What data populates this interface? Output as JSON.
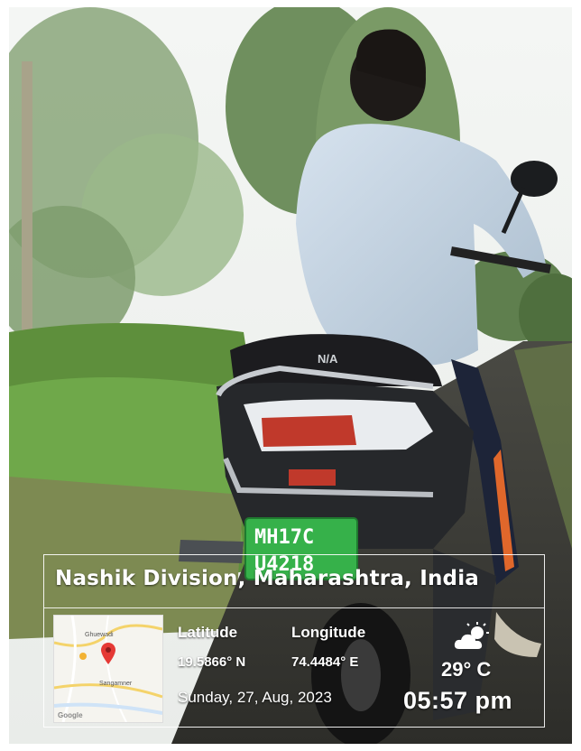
{
  "location": "Nashik Division, Maharashtra, India",
  "coordinates": {
    "latitude_label": "Latitude",
    "latitude_value": "19.5866° N",
    "longitude_label": "Longitude",
    "longitude_value": "74.4484° E"
  },
  "datetime": {
    "date": "Sunday, 27, Aug, 2023",
    "time": "05:57 pm"
  },
  "weather": {
    "temperature": "29° C",
    "icon": "partly-cloudy-icon"
  },
  "map": {
    "place_top": "Ghuewadi",
    "place_bottom": "Sangamner",
    "logo": "Google",
    "pin_color": "#e53935"
  },
  "scene": {
    "plate_line1": "MH17C",
    "plate_line2": "U4218",
    "seat_text": "N/A"
  }
}
